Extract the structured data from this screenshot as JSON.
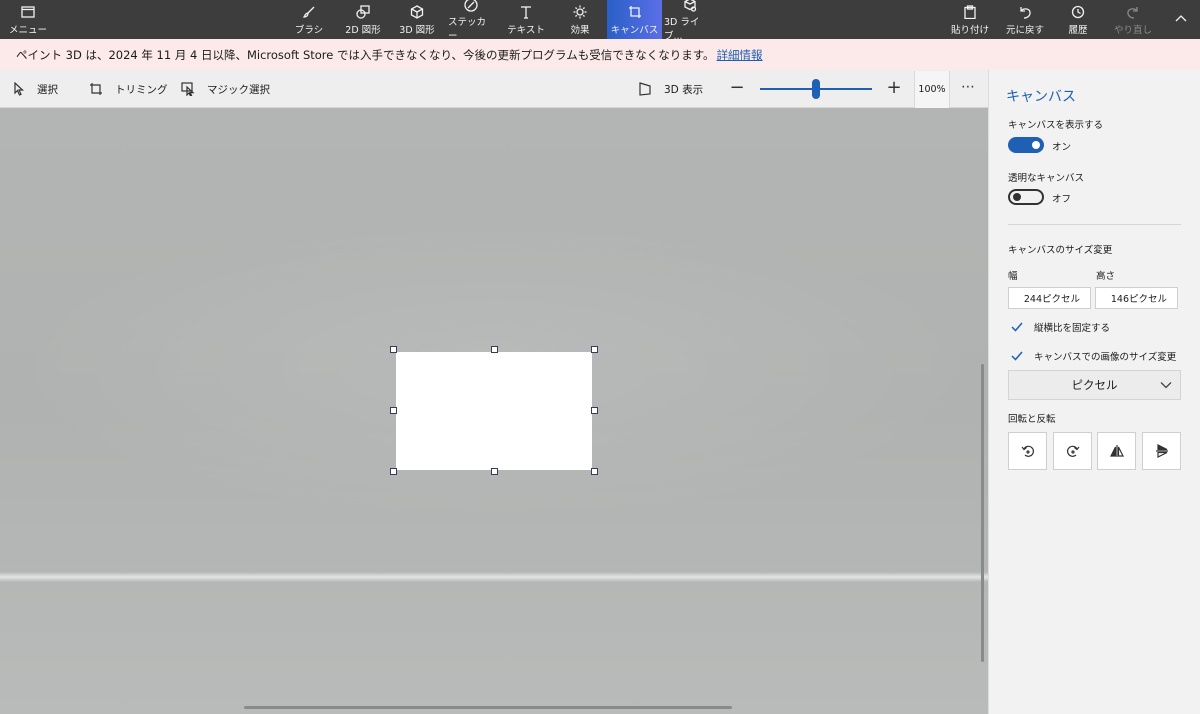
{
  "toolbar": {
    "menu": "メニュー",
    "brush": "ブラシ",
    "shapes2d": "2D 図形",
    "shapes3d": "3D 図形",
    "stickers": "ステッカー",
    "text": "テキスト",
    "effects": "効果",
    "canvas": "キャンバス",
    "library3d": "3D ライブ...",
    "paste": "貼り付け",
    "undo": "元に戻す",
    "history": "履歴",
    "redo": "やり直し"
  },
  "notice": {
    "message": "ペイント 3D は、2024 年 11 月 4 日以降、Microsoft Store では入手できなくなり、今後の更新プログラムも受信できなくなります。",
    "link": "詳細情報"
  },
  "subtoolbar": {
    "select": "選択",
    "crop": "トリミング",
    "magic_select": "マジック選択",
    "view_3d": "3D 表示",
    "zoom_percent": "100%",
    "zoom_level": 0.5
  },
  "panel": {
    "title": "キャンバス",
    "show_canvas_label": "キャンバスを表示する",
    "show_canvas_state": "オン",
    "transparent_label": "透明なキャンバス",
    "transparent_state": "オフ",
    "resize_heading": "キャンバスのサイズ変更",
    "width_label": "幅",
    "height_label": "高さ",
    "width_value": "244ピクセル",
    "height_value": "146ピクセル",
    "lock_aspect": "縦横比を固定する",
    "resize_image": "キャンバスでの画像のサイズ変更",
    "unit_select": "ピクセル",
    "rotate_heading": "回転と反転"
  },
  "colors": {
    "accent": "#1f5fb4",
    "topbar": "#3d3d3d",
    "notice_bg": "#fce9e9"
  }
}
